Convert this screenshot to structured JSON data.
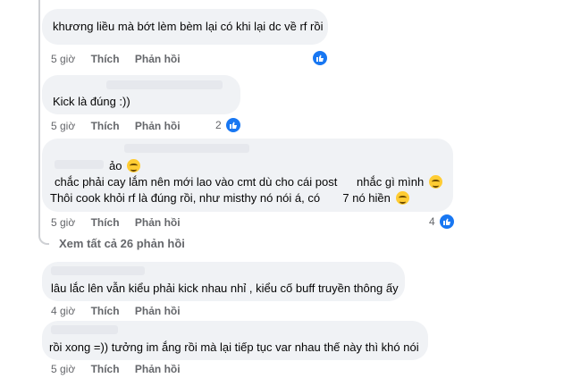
{
  "comments": [
    {
      "text_lines": [
        "khương liều mà bớt lèm bèm lại có khi lại dc về rf rồi"
      ],
      "time": "5 giờ",
      "like_label": "Thích",
      "reply_label": "Phản hồi",
      "reaction_count": ""
    },
    {
      "text_lines": [
        "Kick là đúng :))"
      ],
      "time": "5 giờ",
      "like_label": "Thích",
      "reply_label": "Phản hồi",
      "reaction_count": "2"
    },
    {
      "text_lines": [
        "ảo",
        "chắc phải cay lắm nên mới lao vào cmt dù cho cái post",
        "nhắc gì mình",
        "Thôi cook khỏi rf là đúng rồi, như misthy nó nói á, có",
        "7 nó hiền"
      ],
      "time": "5 giờ",
      "like_label": "Thích",
      "reply_label": "Phản hồi",
      "reaction_count": "4"
    },
    {
      "text_lines": [
        "lâu lắc lên vẫn kiểu phải kick nhau nhỉ , kiểu cố buff truyền thông ấy"
      ],
      "time": "4 giờ",
      "like_label": "Thích",
      "reply_label": "Phản hồi",
      "reaction_count": ""
    },
    {
      "text_lines": [
        "rồi xong =)) tưởng im ắng rồi mà lại tiếp tục var nhau thế này thì khó nói"
      ],
      "time": "5 giờ",
      "like_label": "Thích",
      "reply_label": "Phản hồi",
      "reaction_count": ""
    }
  ],
  "view_more": "Xem tất cả 26 phản hồi",
  "colors": {
    "bubble": "#f0f2f5",
    "meta": "#65676b",
    "like_blue": "#1877f2"
  },
  "icons": {
    "reaction": "like-icon",
    "emoji": "smiling-face-icon"
  }
}
